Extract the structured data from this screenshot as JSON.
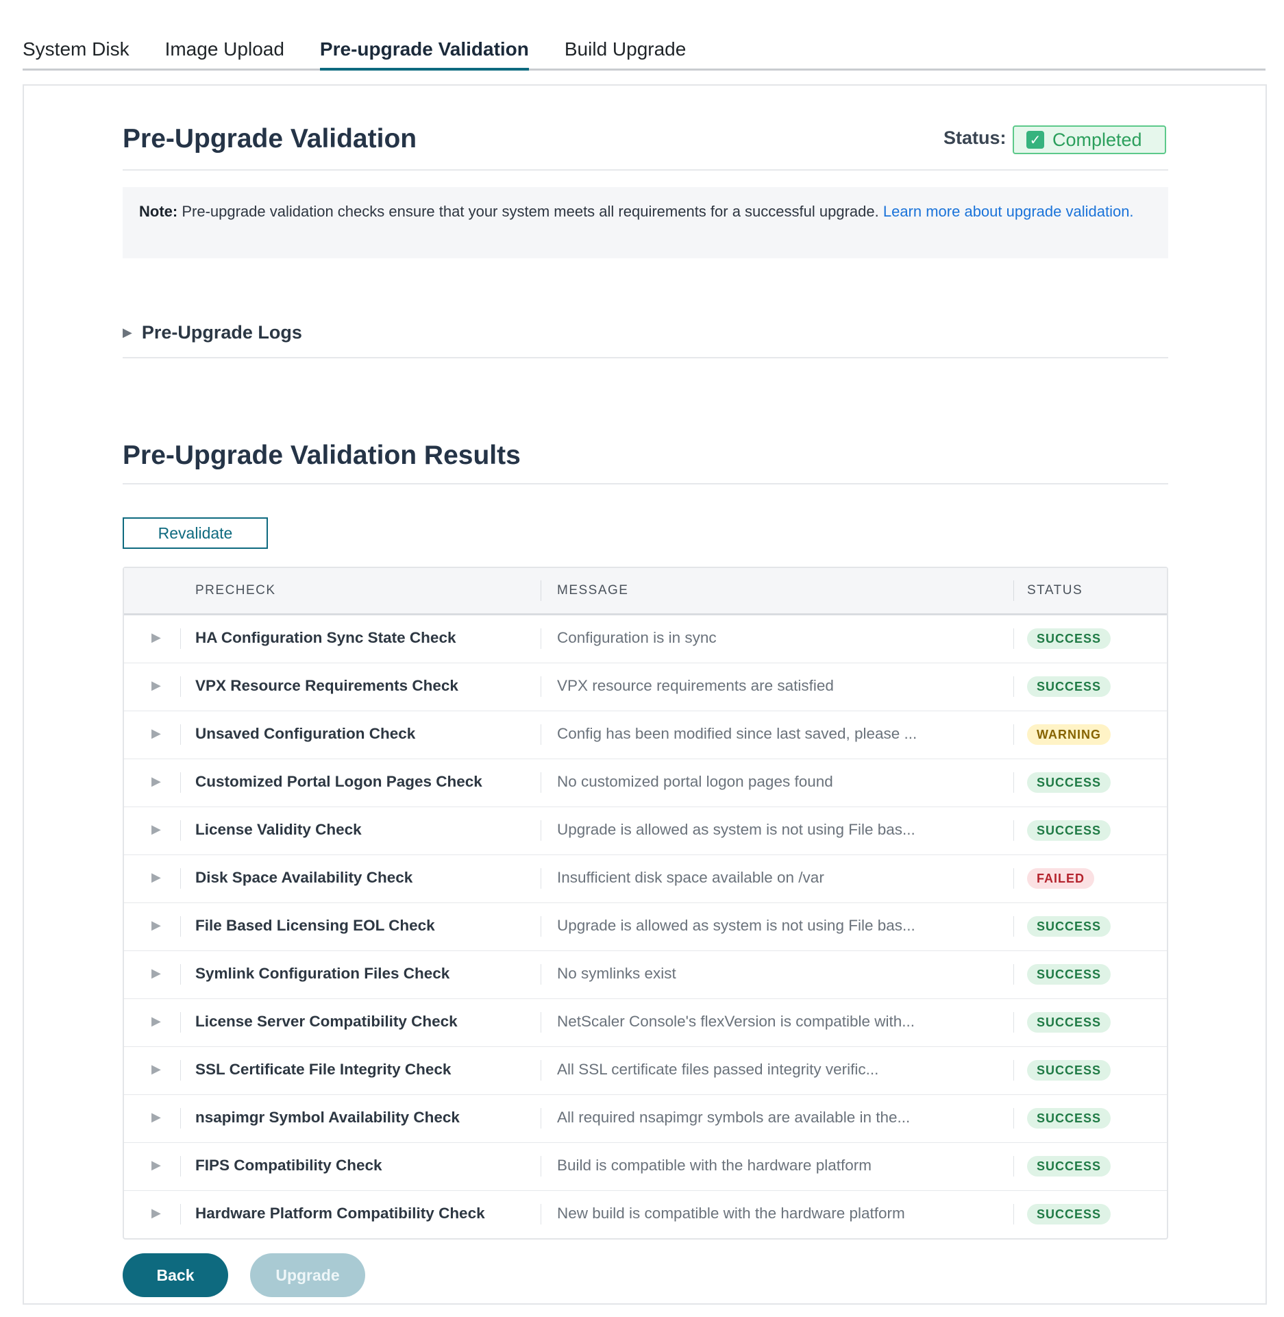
{
  "tabs": [
    {
      "label": "System Disk"
    },
    {
      "label": "Image Upload"
    },
    {
      "label": "Pre-upgrade Validation"
    },
    {
      "label": "Build Upgrade"
    }
  ],
  "header": {
    "title": "Pre-Upgrade Validation",
    "status_label": "Status:",
    "status_value": "Completed"
  },
  "note": {
    "prefix": "Note:",
    "text": " Pre-upgrade validation checks ensure that your system meets all requirements for a successful upgrade. ",
    "link": "Learn more about upgrade validation."
  },
  "logs": {
    "label": "Pre-Upgrade Logs"
  },
  "results": {
    "title": "Pre-Upgrade Validation Results",
    "revalidate_label": "Revalidate",
    "columns": {
      "precheck": "PRECHECK",
      "message": "MESSAGE",
      "status": "STATUS"
    },
    "rows": [
      {
        "precheck": "HA Configuration Sync State Check",
        "message": "Configuration is in sync",
        "status": "SUCCESS",
        "kind": "success"
      },
      {
        "precheck": "VPX Resource Requirements Check",
        "message": "VPX resource requirements are satisfied",
        "status": "SUCCESS",
        "kind": "success"
      },
      {
        "precheck": "Unsaved Configuration Check",
        "message": "Config has been modified since last saved, please ...",
        "status": "WARNING",
        "kind": "warning"
      },
      {
        "precheck": "Customized Portal Logon Pages Check",
        "message": "No customized portal logon pages found",
        "status": "SUCCESS",
        "kind": "success"
      },
      {
        "precheck": "License Validity Check",
        "message": "Upgrade is allowed as system is not using File bas...",
        "status": "SUCCESS",
        "kind": "success"
      },
      {
        "precheck": "Disk Space Availability Check",
        "message": "Insufficient disk space available on /var",
        "status": "FAILED",
        "kind": "failed"
      },
      {
        "precheck": "File Based Licensing EOL Check",
        "message": "Upgrade is allowed as system is not using File bas...",
        "status": "SUCCESS",
        "kind": "success"
      },
      {
        "precheck": "Symlink Configuration Files Check",
        "message": "No symlinks exist",
        "status": "SUCCESS",
        "kind": "success"
      },
      {
        "precheck": "License Server Compatibility Check",
        "message": "NetScaler Console's flexVersion is compatible with...",
        "status": "SUCCESS",
        "kind": "success"
      },
      {
        "precheck": "SSL Certificate File Integrity Check",
        "message": "All SSL certificate files passed integrity verific...",
        "status": "SUCCESS",
        "kind": "success"
      },
      {
        "precheck": "nsapimgr Symbol Availability Check",
        "message": "All required nsapimgr symbols are available in the...",
        "status": "SUCCESS",
        "kind": "success"
      },
      {
        "precheck": "FIPS Compatibility Check",
        "message": "Build is compatible with the hardware platform",
        "status": "SUCCESS",
        "kind": "success"
      },
      {
        "precheck": "Hardware Platform Compatibility Check",
        "message": "New build is compatible with the hardware platform",
        "status": "SUCCESS",
        "kind": "success"
      }
    ]
  },
  "footer": {
    "back_label": "Back",
    "upgrade_label": "Upgrade"
  },
  "icons": {
    "status_check": "check-box-icon",
    "expand": "caret-right-icon"
  },
  "colors": {
    "accent": "#0e6a7f",
    "success": "#1f7a45",
    "warning": "#866300",
    "failed": "#b4232d",
    "link": "#1a73d9"
  }
}
